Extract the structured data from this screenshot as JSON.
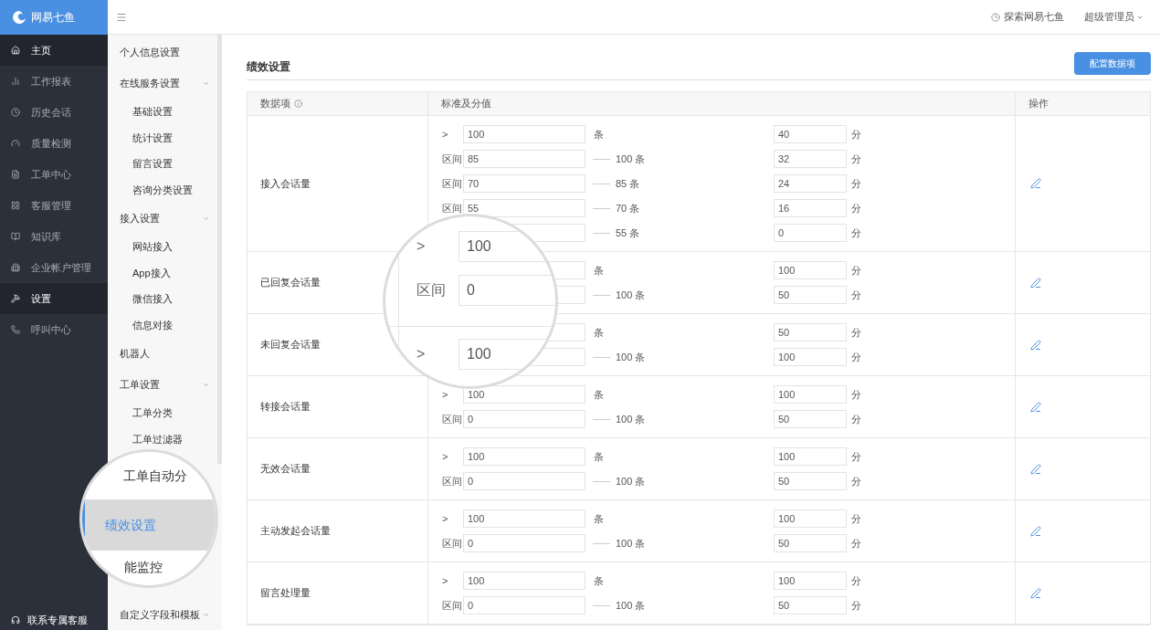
{
  "logo": {
    "text": "网易七鱼"
  },
  "nav": {
    "items": [
      {
        "label": "主页",
        "selected": true
      },
      {
        "label": "工作报表",
        "selected": false
      },
      {
        "label": "历史会话",
        "selected": false
      },
      {
        "label": "质量检测",
        "selected": false
      },
      {
        "label": "工单中心",
        "selected": false
      },
      {
        "label": "客服管理",
        "selected": false
      },
      {
        "label": "知识库",
        "selected": false
      },
      {
        "label": "企业帐户管理",
        "selected": false
      },
      {
        "label": "设置",
        "selected": true
      },
      {
        "label": "呼叫中心",
        "selected": false
      }
    ],
    "footer": "联系专属客服"
  },
  "submenu": [
    {
      "label": "个人信息设置"
    },
    {
      "label": "在线服务设置",
      "expanded": true,
      "children": [
        {
          "label": "基础设置"
        },
        {
          "label": "统计设置"
        },
        {
          "label": "留言设置"
        },
        {
          "label": "咨询分类设置"
        }
      ]
    },
    {
      "label": "接入设置",
      "expanded": true,
      "children": [
        {
          "label": "网站接入"
        },
        {
          "label": "App接入"
        },
        {
          "label": "微信接入"
        },
        {
          "label": "信息对接"
        }
      ]
    },
    {
      "label": "机器人"
    },
    {
      "label": "工单设置",
      "expanded": true,
      "children": [
        {
          "label": "工单分类"
        },
        {
          "label": "工单过滤器"
        }
      ]
    },
    {
      "label": "自定义字段和模板",
      "expanded": true
    }
  ],
  "header": {
    "explore": "探索网易七鱼",
    "user": "超级管理员"
  },
  "page": {
    "title": "绩效设置",
    "button": "配置数据项"
  },
  "table": {
    "columns": [
      "数据项",
      "标准及分值",
      "操作"
    ],
    "rows": [
      {
        "name": "接入会话量",
        "lines": [
          {
            "kind": "gt",
            "prefix": ">",
            "value": "100",
            "suffix": "条",
            "score": "40",
            "score_unit": "分"
          },
          {
            "kind": "range",
            "prefix": "区间",
            "value": "85",
            "suffix": "100 条",
            "score": "32",
            "score_unit": "分"
          },
          {
            "kind": "range",
            "prefix": "区间",
            "value": "70",
            "suffix": "85 条",
            "score": "24",
            "score_unit": "分"
          },
          {
            "kind": "range",
            "prefix": "区间",
            "value": "55",
            "suffix": "70 条",
            "score": "16",
            "score_unit": "分"
          },
          {
            "kind": "range",
            "suffix": "55 条",
            "score": "0",
            "score_unit": "分"
          }
        ]
      },
      {
        "name": "已回复会话量",
        "lines": [
          {
            "kind": "gt",
            "suffix": "条",
            "score": "100",
            "score_unit": "分"
          },
          {
            "kind": "range",
            "suffix": "100 条",
            "score": "50",
            "score_unit": "分"
          }
        ]
      },
      {
        "name": "未回复会话量",
        "lines": [
          {
            "kind": "gt",
            "suffix": "条",
            "score": "50",
            "score_unit": "分"
          },
          {
            "kind": "range",
            "suffix": "100 条",
            "score": "100",
            "score_unit": "分"
          }
        ]
      },
      {
        "name": "转接会话量",
        "lines": [
          {
            "kind": "gt",
            "prefix": ">",
            "value": "100",
            "suffix": "条",
            "score": "100",
            "score_unit": "分"
          },
          {
            "kind": "range",
            "prefix": "区间",
            "value": "0",
            "suffix": "100 条",
            "score": "50",
            "score_unit": "分"
          }
        ]
      },
      {
        "name": "无效会话量",
        "lines": [
          {
            "kind": "gt",
            "prefix": ">",
            "value": "100",
            "suffix": "条",
            "score": "100",
            "score_unit": "分"
          },
          {
            "kind": "range",
            "prefix": "区间",
            "value": "0",
            "suffix": "100 条",
            "score": "50",
            "score_unit": "分"
          }
        ]
      },
      {
        "name": "主动发起会话量",
        "lines": [
          {
            "kind": "gt",
            "prefix": ">",
            "value": "100",
            "suffix": "条",
            "score": "100",
            "score_unit": "分"
          },
          {
            "kind": "range",
            "prefix": "区间",
            "value": "0",
            "suffix": "100 条",
            "score": "50",
            "score_unit": "分"
          }
        ]
      },
      {
        "name": "留言处理量",
        "lines": [
          {
            "kind": "gt",
            "prefix": ">",
            "value": "100",
            "suffix": "条",
            "score": "100",
            "score_unit": "分"
          },
          {
            "kind": "range",
            "prefix": "区间",
            "value": "0",
            "suffix": "100 条",
            "score": "50",
            "score_unit": "分"
          }
        ]
      }
    ]
  },
  "magnifiers": [
    {
      "kind": "table",
      "lines": [
        {
          "prefix": ">",
          "value": "100"
        },
        {
          "prefix": "区间",
          "value": "0"
        },
        {
          "prefix": ">",
          "value": "100"
        }
      ]
    },
    {
      "kind": "menu",
      "items": [
        {
          "label": "工单自动分",
          "selected": false
        },
        {
          "label": "绩效设置",
          "selected": true
        },
        {
          "label": "能监控",
          "selected": false
        }
      ]
    }
  ]
}
